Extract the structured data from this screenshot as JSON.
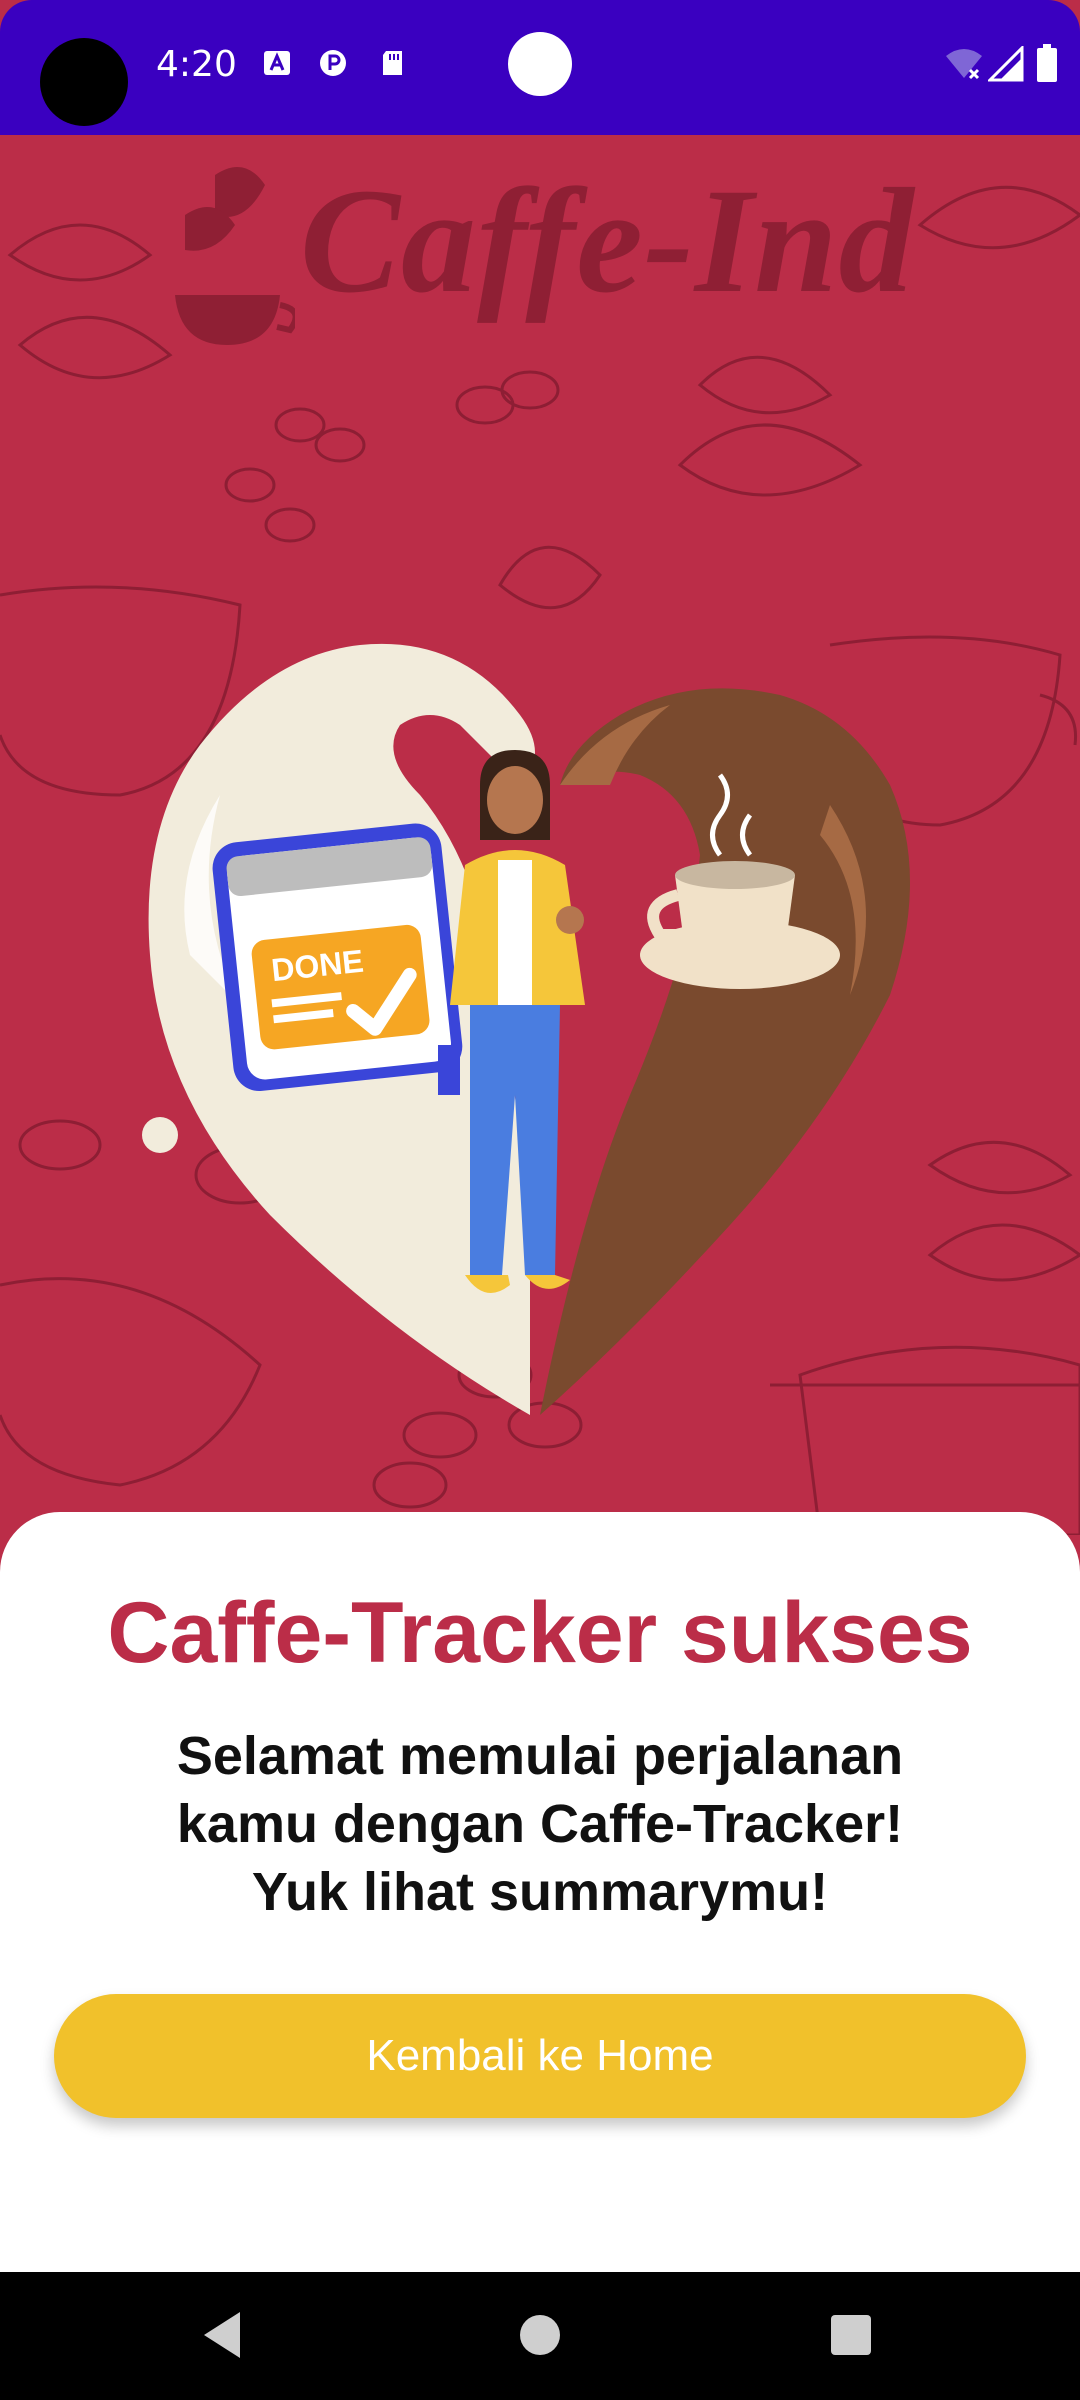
{
  "status_bar": {
    "time": "4:20",
    "background_color": "#3a00c0",
    "icons": [
      "text-a-icon",
      "p-circle-icon",
      "sd-card-icon",
      "wifi-off-icon",
      "cellular-signal-icon",
      "battery-icon"
    ]
  },
  "hero": {
    "brand": "Caffe-Ind",
    "background_color": "#bb2d48",
    "illustration": {
      "badge_text": "DONE"
    }
  },
  "sheet": {
    "title": "Caffe-Tracker sukses",
    "message": "Selamat memulai perjalanan\nkamu dengan Caffe-Tracker!\nYuk lihat summarymu!",
    "button_label": "Kembali ke Home",
    "title_color": "#bb2d48",
    "button_color": "#f1c12b"
  },
  "nav_bar": {
    "buttons": [
      "back-icon",
      "home-icon",
      "recents-icon"
    ]
  }
}
